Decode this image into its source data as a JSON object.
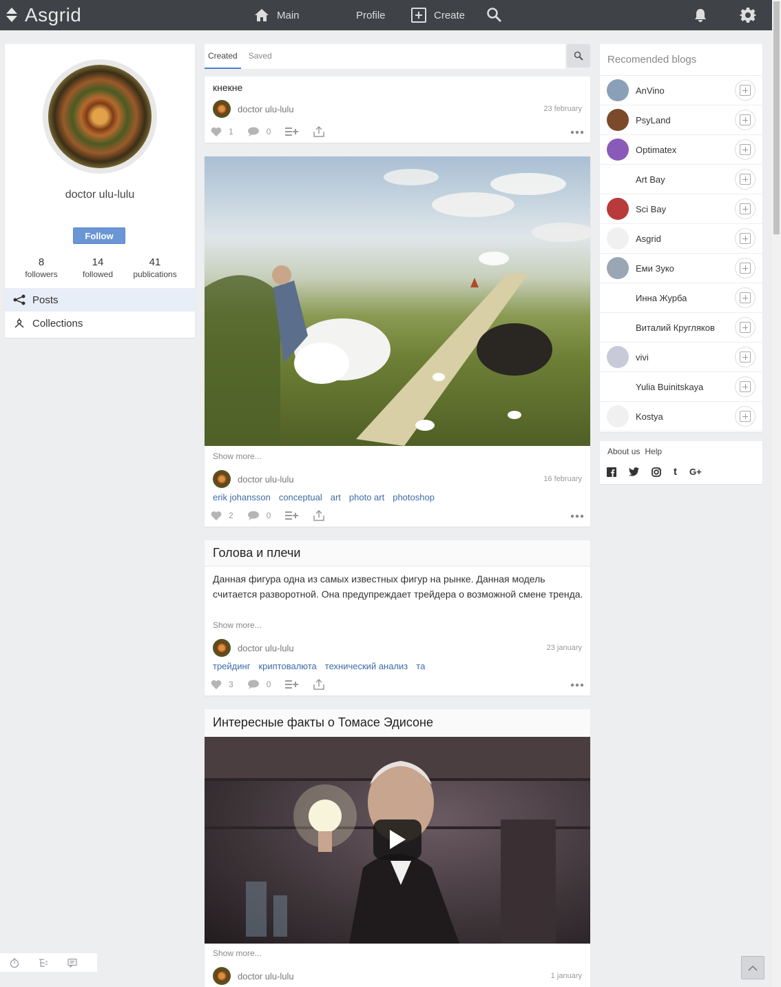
{
  "app": {
    "logo": "Asgrid"
  },
  "nav": {
    "main": "Main",
    "profile": "Profile",
    "create": "Create"
  },
  "profile": {
    "name": "doctor ulu-lulu",
    "follow_label": "Follow",
    "stats": [
      {
        "value": "8",
        "label": "followers"
      },
      {
        "value": "14",
        "label": "followed"
      },
      {
        "value": "41",
        "label": "publications"
      }
    ],
    "menu": [
      {
        "label": "Posts"
      },
      {
        "label": "Collections"
      }
    ]
  },
  "tabs": [
    {
      "label": "Created"
    },
    {
      "label": "Saved"
    }
  ],
  "posts": [
    {
      "title": "кнекне",
      "author": "doctor ulu-lulu",
      "date": "23 february",
      "likes": "1",
      "comments": "0"
    },
    {
      "show_more": "Show more...",
      "author": "doctor ulu-lulu",
      "date": "16 february",
      "tags": [
        "erik johansson",
        "conceptual",
        "art",
        "photo art",
        "photoshop"
      ],
      "likes": "2",
      "comments": "0"
    },
    {
      "title": "Голова и плечи",
      "text": "Данная фигура одна из самых известных фигур на рынке. Данная модель считается разворотной. Она предупреждает трейдера о возможной смене тренда.",
      "show_more": "Show more...",
      "author": "doctor ulu-lulu",
      "date": "23 january",
      "tags": [
        "трейдинг",
        "криптовалюта",
        "технический анализ",
        "та"
      ],
      "likes": "3",
      "comments": "0"
    },
    {
      "title": "Интересные факты о Томасе Эдисоне",
      "show_more": "Show more...",
      "author": "doctor ulu-lulu",
      "date": "1 january"
    }
  ],
  "recommended": {
    "title": "Recomended blogs",
    "items": [
      {
        "name": "AnVino",
        "color": "#8aa0b8"
      },
      {
        "name": "PsyLand",
        "color": "#7a4a2a"
      },
      {
        "name": "Optimatex",
        "color": "#8a5ab8"
      },
      {
        "name": "Art Bay",
        "color": "#ffffff"
      },
      {
        "name": "Sci Bay",
        "color": "#b83a3a"
      },
      {
        "name": "Asgrid",
        "color": "#f0f0f0"
      },
      {
        "name": "Еми Зуко",
        "color": "#9aa6b4"
      },
      {
        "name": "Инна Журба",
        "color": "#ffffff"
      },
      {
        "name": "Виталий Кругляков",
        "color": "#ffffff"
      },
      {
        "name": "vivi",
        "color": "#c8cad8"
      },
      {
        "name": "Yulia Buinitskaya",
        "color": "#ffffff"
      },
      {
        "name": "Kostya",
        "color": "#f0f0f0"
      }
    ]
  },
  "footer": {
    "links": [
      "About us",
      "Help"
    ],
    "social": [
      "f",
      "t",
      "ig",
      "t",
      "G+"
    ]
  },
  "colors": {
    "accent": "#6b96d6",
    "topbar": "#3f4247",
    "tag": "#3e6aa8"
  }
}
